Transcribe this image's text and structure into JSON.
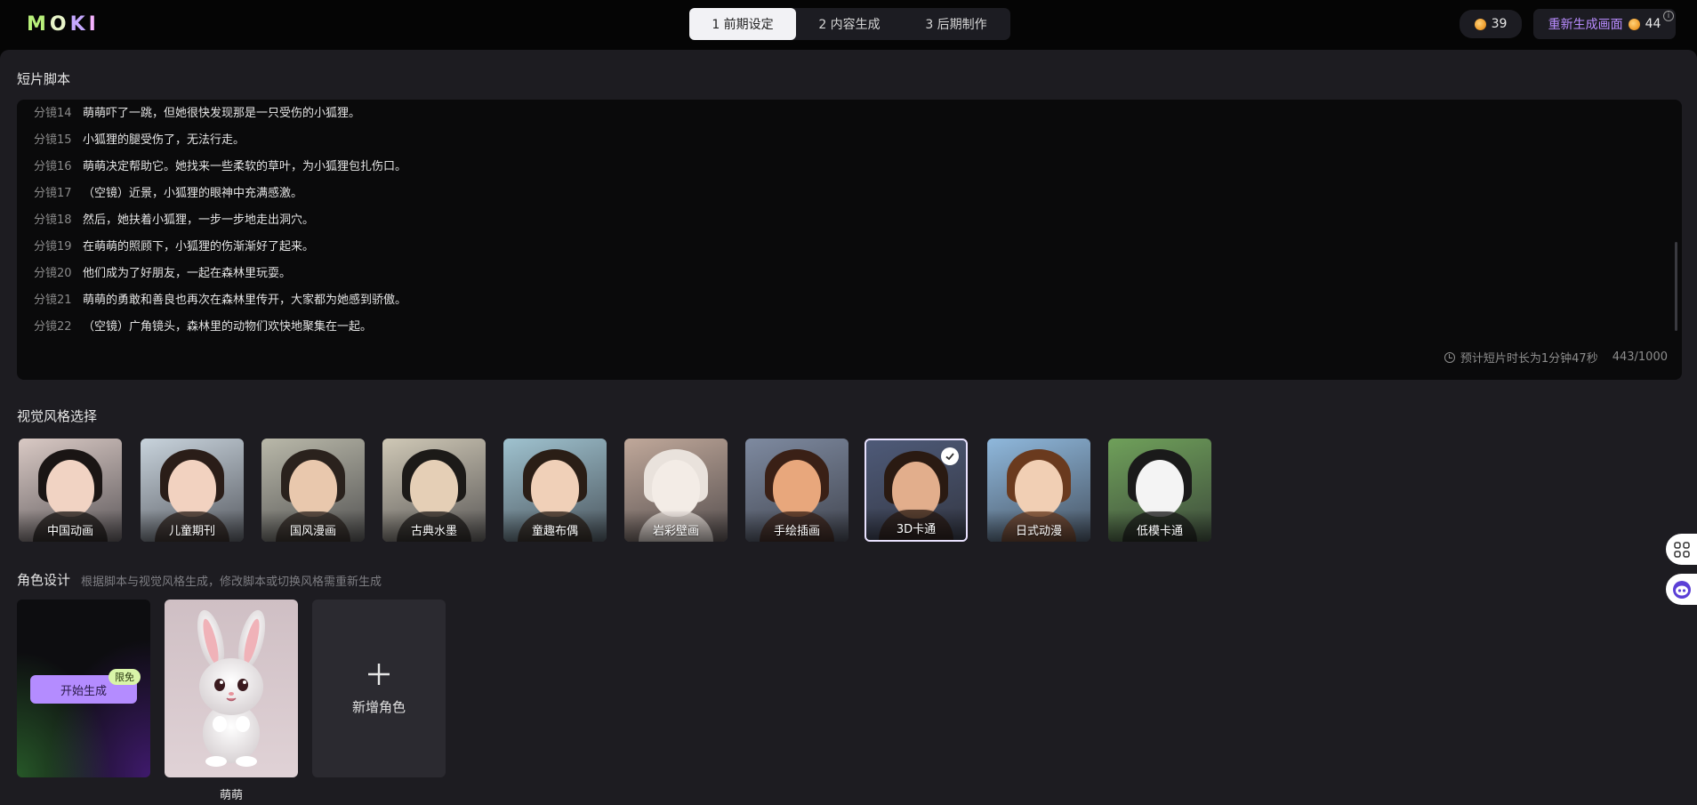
{
  "app": {
    "logo_text": "MOKI",
    "accent_color": "#b98cff",
    "steps": [
      "1 前期设定",
      "2 内容生成",
      "3 后期制作"
    ],
    "active_step": 0,
    "points": "39",
    "regenerate_label": "重新生成画面",
    "regenerate_cost": "44"
  },
  "script": {
    "title": "短片脚本",
    "lines": [
      {
        "shot": "分镜14",
        "text": "萌萌吓了一跳，但她很快发现那是一只受伤的小狐狸。"
      },
      {
        "shot": "分镜15",
        "text": "小狐狸的腿受伤了，无法行走。"
      },
      {
        "shot": "分镜16",
        "text": "萌萌决定帮助它。她找来一些柔软的草叶，为小狐狸包扎伤口。"
      },
      {
        "shot": "分镜17",
        "text": "（空镜）近景，小狐狸的眼神中充满感激。"
      },
      {
        "shot": "分镜18",
        "text": "然后，她扶着小狐狸，一步一步地走出洞穴。"
      },
      {
        "shot": "分镜19",
        "text": "在萌萌的照顾下，小狐狸的伤渐渐好了起来。"
      },
      {
        "shot": "分镜20",
        "text": "他们成为了好朋友，一起在森林里玩耍。"
      },
      {
        "shot": "分镜21",
        "text": "萌萌的勇敢和善良也再次在森林里传开，大家都为她感到骄傲。"
      },
      {
        "shot": "分镜22",
        "text": "（空镜）广角镜头，森林里的动物们欢快地聚集在一起。"
      }
    ],
    "duration": "预计短片时长为1分钟47秒",
    "char_count": "443/1000"
  },
  "styles": {
    "title": "视觉风格选择",
    "selected_index": 7,
    "items": [
      {
        "label": "中国动画",
        "bg": "#d9c9c4",
        "hair": "#1a1514",
        "skin": "#f1d3c3"
      },
      {
        "label": "儿童期刊",
        "bg": "#c8d3dc",
        "hair": "#2a1d18",
        "skin": "#f2d2c0"
      },
      {
        "label": "国风漫画",
        "bg": "#b9b8a9",
        "hair": "#2a221d",
        "skin": "#e9c8ad"
      },
      {
        "label": "古典水墨",
        "bg": "#cfc8b6",
        "hair": "#1c1a18",
        "skin": "#e5cfb6"
      },
      {
        "label": "童趣布偶",
        "bg": "#9fc2cf",
        "hair": "#2a1e16",
        "skin": "#f0d0b8"
      },
      {
        "label": "岩彩壁画",
        "bg": "#c0a89a",
        "hair": "#e9e2dc",
        "skin": "#f3ece6"
      },
      {
        "label": "手绘插画",
        "bg": "#7e8aa0",
        "hair": "#3a2016",
        "skin": "#e8a77c"
      },
      {
        "label": "3D卡通",
        "bg": "#4e5a78",
        "hair": "#2a1a12",
        "skin": "#e2ae8c"
      },
      {
        "label": "日式动漫",
        "bg": "#8fb8dc",
        "hair": "#6a3a1e",
        "skin": "#f1cfb4"
      },
      {
        "label": "低模卡通",
        "bg": "#6fa05a",
        "hair": "#1a1a1a",
        "skin": "#f4f4f4"
      }
    ]
  },
  "characters": {
    "title": "角色设计",
    "hint": "根据脚本与视觉风格生成，修改脚本或切换风格需重新生成",
    "generate_label": "开始生成",
    "free_badge": "限免",
    "bunny_name": "萌萌",
    "add_label": "新增角色"
  }
}
